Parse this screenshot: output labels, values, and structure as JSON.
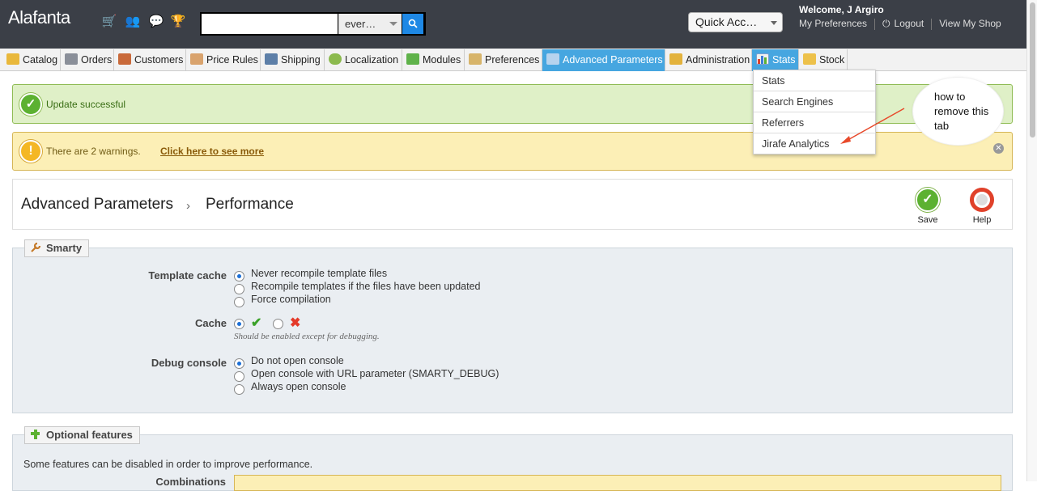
{
  "app": {
    "brand": "Alafanta"
  },
  "topbar": {
    "icons": [
      "cart-icon",
      "customers-icon",
      "messages-icon",
      "trophy-icon"
    ],
    "search": {
      "value": "",
      "placeholder": "",
      "type_label": "ever…"
    },
    "quick_access": "Quick Acc…",
    "welcome": "Welcome, J Argiro",
    "links": {
      "preferences": "My Preferences",
      "logout": "Logout",
      "view_shop": "View My Shop"
    }
  },
  "tabs": [
    {
      "label": "Catalog",
      "icon": "folder-icon"
    },
    {
      "label": "Orders",
      "icon": "cart-icon"
    },
    {
      "label": "Customers",
      "icon": "person-icon"
    },
    {
      "label": "Price Rules",
      "icon": "price-icon"
    },
    {
      "label": "Shipping",
      "icon": "truck-icon"
    },
    {
      "label": "Localization",
      "icon": "globe-icon"
    },
    {
      "label": "Modules",
      "icon": "puzzle-icon"
    },
    {
      "label": "Preferences",
      "icon": "preferences-icon"
    },
    {
      "label": "Advanced Parameters",
      "icon": "wrench-icon",
      "active": true
    },
    {
      "label": "Administration",
      "icon": "key-icon"
    },
    {
      "label": "Stats",
      "icon": "chart-icon",
      "open": true
    },
    {
      "label": "Stock",
      "icon": "box-icon"
    }
  ],
  "stats_menu": [
    "Stats",
    "Search Engines",
    "Referrers",
    "Jirafe Analytics"
  ],
  "annotation": {
    "text": "how to remove this tab"
  },
  "alerts": {
    "success": "Update successful",
    "warning": "There are 2 warnings.",
    "warning_link": "Click here to see more"
  },
  "page": {
    "breadcrumb": [
      "Advanced Parameters",
      "Performance"
    ],
    "save_label": "Save",
    "help_label": "Help"
  },
  "smarty": {
    "legend": "Smarty",
    "template_cache": {
      "label": "Template cache",
      "options": [
        "Never recompile template files",
        "Recompile templates if the files have been updated",
        "Force compilation"
      ],
      "selected": 0
    },
    "cache": {
      "label": "Cache",
      "hint": "Should be enabled except for debugging.",
      "selected": "yes"
    },
    "debug_console": {
      "label": "Debug console",
      "options": [
        "Do not open console",
        "Open console with URL parameter (SMARTY_DEBUG)",
        "Always open console"
      ],
      "selected": 0
    }
  },
  "optional": {
    "legend": "Optional features",
    "description": "Some features can be disabled in order to improve performance.",
    "first_field_label": "Combinations"
  }
}
